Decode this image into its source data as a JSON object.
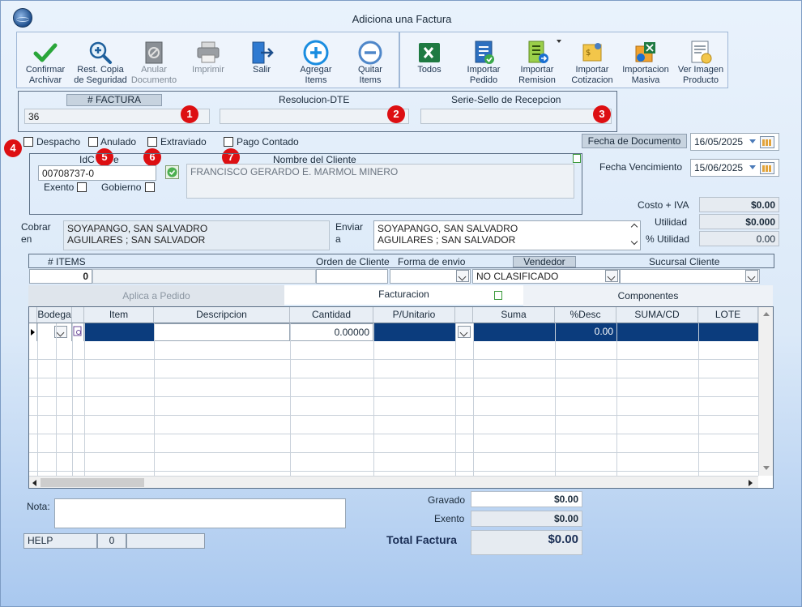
{
  "window": {
    "title": "Adiciona una Factura"
  },
  "toolbar": {
    "buttons": [
      {
        "line1": "Confirmar",
        "line2": "Archivar"
      },
      {
        "line1": "Rest. Copia",
        "line2": "de Seguridad"
      },
      {
        "line1": "Anular",
        "line2": "Documento"
      },
      {
        "line1": "Imprimir",
        "line2": ""
      },
      {
        "line1": "Salir",
        "line2": ""
      },
      {
        "line1": "Agregar",
        "line2": "Items"
      },
      {
        "line1": "Quitar",
        "line2": "Items"
      }
    ],
    "import_buttons": [
      {
        "line1": "Todos",
        "line2": ""
      },
      {
        "line1": "Importar",
        "line2": "Pedido"
      },
      {
        "line1": "Importar",
        "line2": "Remision"
      },
      {
        "line1": "Importar",
        "line2": "Cotizacion"
      },
      {
        "line1": "Importacion",
        "line2": "Masiva"
      },
      {
        "line1": "Ver Imagen",
        "line2": "Producto"
      }
    ]
  },
  "header": {
    "factura_label": "# FACTURA",
    "factura_value": "36",
    "resolucion_label": "Resolucion-DTE",
    "resolucion_value": "",
    "serie_label": "Serie-Sello de Recepcion",
    "serie_value": ""
  },
  "badges": [
    "1",
    "2",
    "3",
    "4",
    "5",
    "6",
    "7"
  ],
  "options": {
    "despacho": "Despacho",
    "anulado": "Anulado",
    "extraviado": "Extraviado",
    "pago_contado": "Pago Contado"
  },
  "dates": {
    "fecha_documento_label": "Fecha de  Documento",
    "fecha_documento": "16/05/2025",
    "fecha_vencimiento_label": "Fecha Vencimiento",
    "fecha_vencimiento": "15/06/2025"
  },
  "client": {
    "id_label_a": "IdC",
    "id_label_b": "e",
    "id_value": "00708737-0",
    "nombre_label": "Nombre del Cliente",
    "nombre_value": "FRANCISCO GERARDO E. MARMOL MINERO",
    "exento_label": "Exento",
    "gobierno_label": "Gobierno"
  },
  "costs": {
    "costo_iva_label": "Costo + IVA",
    "costo_iva": "$0.00",
    "utilidad_label": "Utilidad",
    "utilidad": "$0.000",
    "pct_utilidad_label": "% Utilidad",
    "pct_utilidad": "0.00"
  },
  "address": {
    "cobrar_label_1": "Cobrar",
    "cobrar_label_2": "en",
    "cobrar_line1": "SOYAPANGO, SAN SALVADRO",
    "cobrar_line2": "AGUILARES ; SAN SALVADOR",
    "enviar_label_1": "Enviar",
    "enviar_label_2": "a",
    "enviar_line1": "SOYAPANGO, SAN SALVADRO",
    "enviar_line2": "AGUILARES ; SAN SALVADOR"
  },
  "order": {
    "items_label": "# ITEMS",
    "items_value": "0",
    "orden_cliente_label": "Orden de Cliente",
    "forma_envio_label": "Forma de envio",
    "vendedor_label": "Vendedor",
    "vendedor_value": "NO CLASIFICADO",
    "sucursal_label": "Sucursal Cliente"
  },
  "tabs": {
    "aplica_pedido": "Aplica a Pedido",
    "facturacion": "Facturacion",
    "componentes": "Componentes"
  },
  "grid": {
    "columns": [
      "Bodega",
      "Item",
      "Descripcion",
      "Cantidad",
      "P/Unitario",
      "Suma",
      "%Desc",
      "SUMA/CD",
      "LOTE"
    ],
    "row": {
      "cantidad": "0.00000",
      "desc": "0.00"
    }
  },
  "footer": {
    "nota_label": "Nota:",
    "gravado_label": "Gravado",
    "gravado": "$0.00",
    "exento_label": "Exento",
    "exento": "$0.00",
    "total_label": "Total Factura",
    "total": "$0.00",
    "help_label": "HELP",
    "help_value": "0"
  },
  "colors": {
    "badge": "#dd0f12",
    "selected_row": "#0b3c7d",
    "confirm": "#2aa63a"
  }
}
